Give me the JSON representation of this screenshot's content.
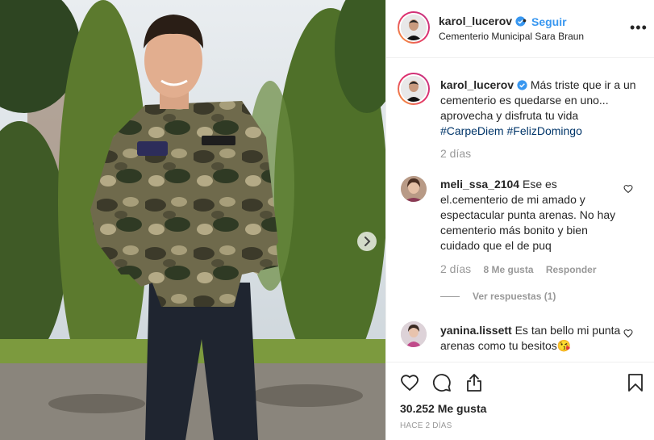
{
  "post": {
    "username": "karol_lucerov",
    "follow_label": "Seguir",
    "separator": "•",
    "location": "Cementerio Municipal Sara Braun",
    "more_icon": "more-options-icon",
    "caption_text": "Más triste que ir a un cementerio es quedarse en uno... aprovecha y disfruta tu vida",
    "hashtags": [
      "#CarpeDiem",
      "#FelizDomingo"
    ],
    "caption_time": "2 días",
    "likes": "30.252 Me gusta",
    "posted_ago": "HACE 2 DÍAS"
  },
  "comments": [
    {
      "username": "meli_ssa_2104",
      "text": "Ese es el.cementerio de mi amado y espectacular punta arenas. No hay cementerio más bonito y bien cuidado que el de puq",
      "time": "2 días",
      "likes": "8 Me gusta",
      "reply_label": "Responder",
      "view_replies": "Ver respuestas (1)"
    },
    {
      "username": "yanina.lissett",
      "text": "Es tan bello mi punta arenas como tu besitos",
      "emoji": "😘"
    }
  ],
  "colors": {
    "accent": "#3897f0",
    "hashtag": "#003569",
    "muted": "#999999",
    "verified": "#3897f0"
  }
}
